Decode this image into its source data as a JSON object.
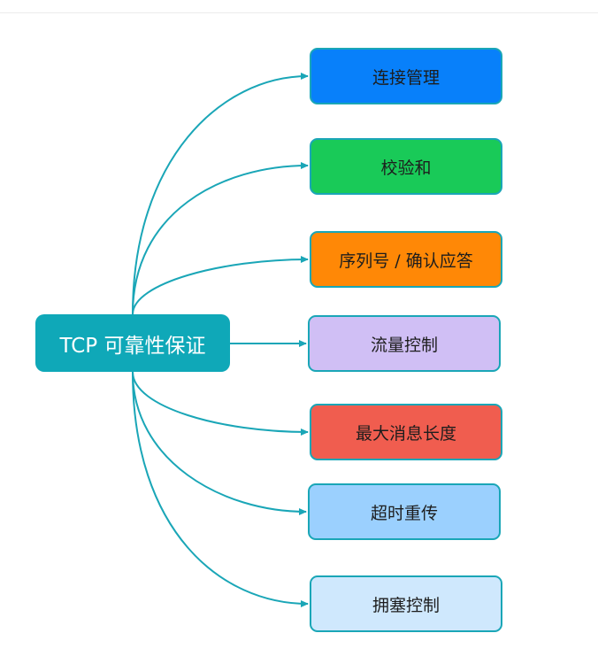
{
  "root": {
    "label": "TCP 可靠性保证"
  },
  "children": [
    {
      "label": "连接管理",
      "fill": "#0880fa",
      "text_color": "#1d1d1d"
    },
    {
      "label": "校验和",
      "fill": "#19ca58",
      "text_color": "#1d1d1d"
    },
    {
      "label": "序列号 / 确认应答",
      "fill": "#ff8806",
      "text_color": "#1d1d1d"
    },
    {
      "label": "流量控制",
      "fill": "#d0bff5",
      "text_color": "#1d1d1d"
    },
    {
      "label": "最大消息长度",
      "fill": "#f05d4f",
      "text_color": "#1d1d1d"
    },
    {
      "label": "超时重传",
      "fill": "#9bd0fe",
      "text_color": "#1d1d1d"
    },
    {
      "label": "拥塞控制",
      "fill": "#cfe8fd",
      "text_color": "#1d1d1d"
    }
  ],
  "colors": {
    "root_fill": "#0fa8b8",
    "connector": "#1aa6b7"
  }
}
